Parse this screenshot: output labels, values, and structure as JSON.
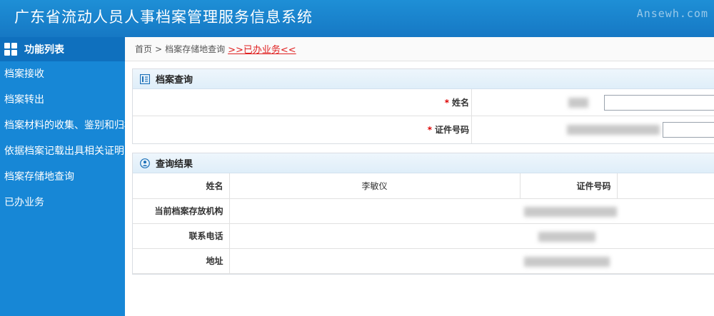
{
  "header": {
    "title": "广东省流动人员人事档案管理服务信息系统",
    "watermark": "Ansewh.com"
  },
  "sidebar": {
    "heading": "功能列表",
    "items": [
      {
        "label": "档案接收"
      },
      {
        "label": "档案转出"
      },
      {
        "label": "档案材料的收集、鉴别和归档"
      },
      {
        "label": "依据档案记载出具相关证明"
      },
      {
        "label": "档案存储地查询"
      },
      {
        "label": "已办业务"
      }
    ]
  },
  "breadcrumb": {
    "home": "首页",
    "separator": ">",
    "page": "档案存储地查询",
    "current": ">>已办业务<<"
  },
  "query_panel": {
    "title": "档案查询",
    "required_mark": "*",
    "name_label": "姓名",
    "id_label": "证件号码"
  },
  "result_panel": {
    "title": "查询结果",
    "name_label": "姓名",
    "name_value": "李敏仪",
    "id_label": "证件号码",
    "org_label": "当前档案存放机构",
    "phone_label": "联系电话",
    "address_label": "地址"
  },
  "colors": {
    "header_bg": "#1678c4",
    "sidebar_bg": "#1787d6",
    "sidebar_head_bg": "#0f70be",
    "link_red": "#e02020"
  }
}
